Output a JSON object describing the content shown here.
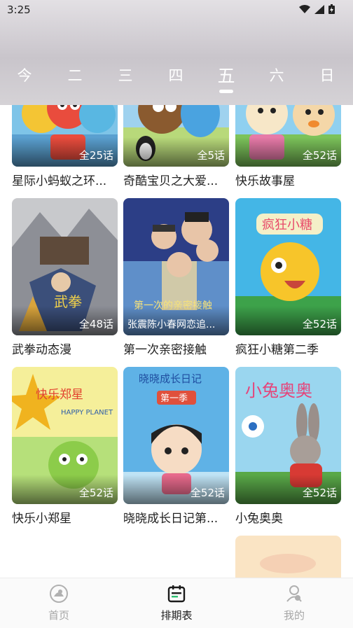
{
  "status_bar": {
    "time": "3:25"
  },
  "weekdays": [
    {
      "label": "今"
    },
    {
      "label": "二"
    },
    {
      "label": "三"
    },
    {
      "label": "四"
    },
    {
      "label": "五"
    },
    {
      "label": "六"
    },
    {
      "label": "日"
    }
  ],
  "active_day": "五",
  "cards": [
    {
      "title": "星际小蚂蚁之环...",
      "episodes": "全25话"
    },
    {
      "title": "奇酷宝贝之大爱...",
      "episodes": "全5话"
    },
    {
      "title": "快乐故事屋",
      "episodes": "全52话"
    },
    {
      "title": "武拳动态漫",
      "episodes": "全48话"
    },
    {
      "title": "第一次亲密接触",
      "episodes": "",
      "subtitle": "张震陈小春网恋追..."
    },
    {
      "title": "疯狂小糖第二季",
      "episodes": "全52话"
    },
    {
      "title": "快乐小郑星",
      "episodes": "全52话"
    },
    {
      "title": "晓晓成长日记第...",
      "episodes": "全52话"
    },
    {
      "title": "小兔奥奥",
      "episodes": "全52话"
    }
  ],
  "poster_text": {
    "card4": "武拳",
    "card5": "第一次的亲密接触",
    "card6": "疯狂小糖",
    "card7": "快乐郑星",
    "card7_en": "HAPPY PLANET",
    "card8_a": "晓晓成长日记",
    "card8_b": "第一季",
    "card9": "小兔奥奥"
  },
  "tabbar": {
    "items": [
      {
        "label": "首页"
      },
      {
        "label": "排期表"
      },
      {
        "label": "我的"
      }
    ],
    "active": "排期表"
  },
  "colors": {
    "accent": "#1a1a1a",
    "inactive": "#a6a6a6"
  }
}
